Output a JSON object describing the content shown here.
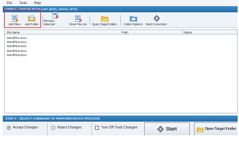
{
  "menu": [
    "File",
    "Tools",
    "Help"
  ],
  "step1_title": "STEP 1 : ADD FILES IN LIST (DOC, DOCX, RTF)",
  "toolbar": {
    "add_files": "Add Files",
    "add_folder": "Add Folder",
    "remove_selected": "Remove Selected",
    "clear_file_list": "Clear File List",
    "open_target_folder": "Open Target Folder",
    "folder_options": "Folder Options",
    "start_conversion": "Start Conversion"
  },
  "table": {
    "columns": [
      "File Name",
      "Path",
      "Status"
    ],
    "rows": [
      "WordFile1.docx",
      "WordFile2.docx",
      "WordFile3.docx",
      "WordFile4.docx",
      "WordFile5.docx"
    ]
  },
  "step2_title": "STEP 2 : SELECT COMMAND TO PERFORM BATCH PROCESS",
  "bottom": {
    "accept_changes": "Accept Changes",
    "reject_changes": "Reject Changes",
    "turn_off_track": "Turn Off Track Changes",
    "start": "Start",
    "open_target_folder": "Open Target Folder"
  },
  "colors": {
    "header_blue": "#2d77b6",
    "highlight_red": "#e23a3a"
  }
}
